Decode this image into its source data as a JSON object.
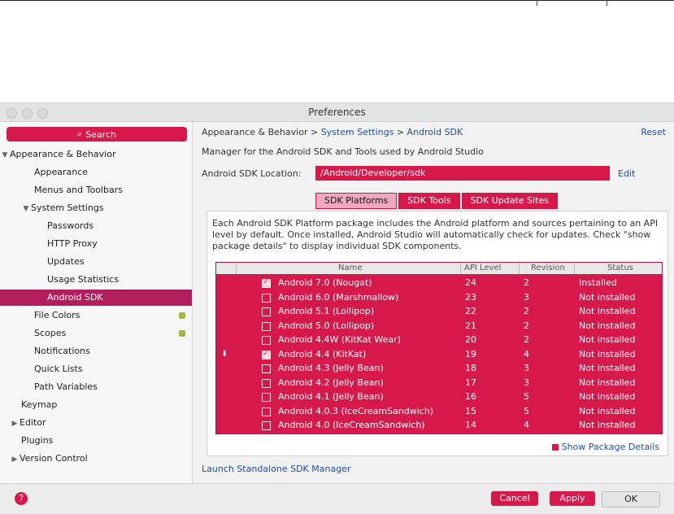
{
  "window": {
    "title": "Preferences"
  },
  "sidebar": {
    "search_label": "Search",
    "items": [
      {
        "label": "Appearance & Behavior",
        "expanded": true,
        "level": 0
      },
      {
        "label": "Appearance",
        "level": 1
      },
      {
        "label": "Menus and Toolbars",
        "level": 1
      },
      {
        "label": "System Settings",
        "expanded": true,
        "level": 1
      },
      {
        "label": "Passwords",
        "level": 2
      },
      {
        "label": "HTTP Proxy",
        "level": 2
      },
      {
        "label": "Updates",
        "level": 2
      },
      {
        "label": "Usage Statistics",
        "level": 2
      },
      {
        "label": "Android SDK",
        "level": 2,
        "selected": true
      },
      {
        "label": "File Colors",
        "level": 1
      },
      {
        "label": "Scopes",
        "level": 1
      },
      {
        "label": "Notifications",
        "level": 1
      },
      {
        "label": "Quick Lists",
        "level": 1
      },
      {
        "label": "Path Variables",
        "level": 1
      },
      {
        "label": "Keymap",
        "level": 0
      },
      {
        "label": "Editor",
        "level": 0
      },
      {
        "label": "Plugins",
        "level": 0
      },
      {
        "label": "Version Control",
        "level": 0
      }
    ]
  },
  "main": {
    "breadcrumb": {
      "prefix": "Appearance & Behavior",
      "sep1": " > ",
      "mid": "System Settings",
      "sep2": " > ",
      "leaf": "Android SDK"
    },
    "reset_label": "Reset",
    "description": "Manager for the Android SDK and Tools used by Android Studio",
    "sdk_location_label": "Android SDK Location:",
    "sdk_location_value": "/Android/Developer/sdk",
    "edit_label": "Edit",
    "tabs": [
      {
        "label": "SDK Platforms",
        "active": true
      },
      {
        "label": "SDK Tools",
        "active": false
      },
      {
        "label": "SDK Update Sites",
        "active": false
      }
    ],
    "panel_description": "Each Android SDK Platform package includes the Android platform and sources pertaining to an API level by default. Once installed, Android Studio will automatically check for updates. Check \"show package details\" to display individual SDK components.",
    "table": {
      "headers": [
        "Name",
        "API Level",
        "Revision",
        "Status"
      ],
      "rows": [
        {
          "name": "Android 7.0 (Nougat)",
          "api": "24",
          "rev": "2",
          "status": "Installed",
          "checked": true
        },
        {
          "name": "Android 6.0 (Marshmallow)",
          "api": "23",
          "rev": "3",
          "status": "Not installed",
          "checked": false
        },
        {
          "name": "Android 5.1 (Lollipop)",
          "api": "22",
          "rev": "2",
          "status": "Not installed",
          "checked": false
        },
        {
          "name": "Android 5.0 (Lollipop)",
          "api": "21",
          "rev": "2",
          "status": "Not installed",
          "checked": false
        },
        {
          "name": "Android 4.4W (KitKat Wear)",
          "api": "20",
          "rev": "2",
          "status": "Not installed",
          "checked": false
        },
        {
          "name": "Android 4.4 (KitKat)",
          "api": "19",
          "rev": "4",
          "status": "Not installed",
          "checked": true,
          "download": true
        },
        {
          "name": "Android 4.3 (Jelly Bean)",
          "api": "18",
          "rev": "3",
          "status": "Not installed",
          "checked": false
        },
        {
          "name": "Android 4.2 (Jelly Bean)",
          "api": "17",
          "rev": "3",
          "status": "Not installed",
          "checked": false
        },
        {
          "name": "Android 4.1 (Jelly Bean)",
          "api": "16",
          "rev": "5",
          "status": "Not installed",
          "checked": false
        },
        {
          "name": "Android 4.0.3 (IceCreamSandwich)",
          "api": "15",
          "rev": "5",
          "status": "Not installed",
          "checked": false
        },
        {
          "name": "Android 4.0 (IceCreamSandwich)",
          "api": "14",
          "rev": "4",
          "status": "Not installed",
          "checked": false
        }
      ]
    },
    "show_details_label": "Show Package Details",
    "launch_label": "Launch Standalone SDK Manager"
  },
  "footer": {
    "help_label": "?",
    "cancel_label": "Cancel",
    "apply_label": "Apply",
    "ok_label": "OK"
  },
  "colors": {
    "accent": "#d6194a",
    "selection": "#b11e5b",
    "link": "#1e4fa8"
  }
}
